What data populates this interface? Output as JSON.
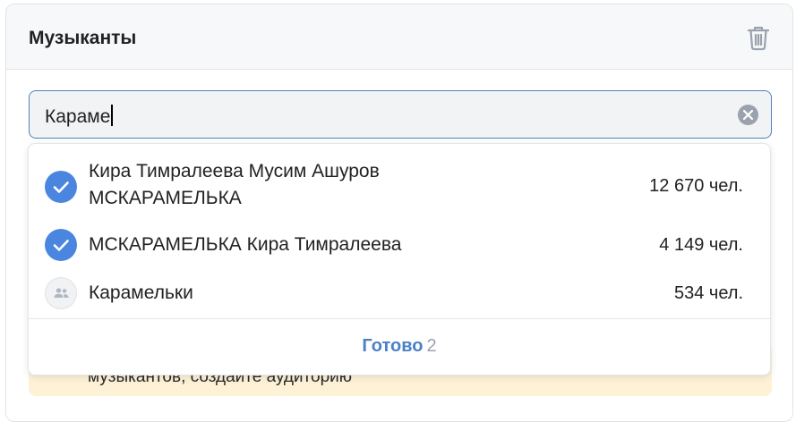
{
  "card": {
    "title": "Музыканты"
  },
  "search": {
    "value": "Караме"
  },
  "warning": {
    "text": "музыкантов, создайте аудиторию"
  },
  "dropdown": {
    "options": [
      {
        "label": "Кира Тимралеева Мусим Ашуров МСКАРАМЕЛЬКА",
        "count": "12 670 чел.",
        "icon": "check-icon",
        "selected": true
      },
      {
        "label": "МСКАРАМЕЛЬКА Кира Тимралеева",
        "count": "4 149 чел.",
        "icon": "check-icon",
        "selected": true
      },
      {
        "label": "Карамельки",
        "count": "534 чел.",
        "icon": "people-icon",
        "selected": false
      }
    ],
    "done_label": "Готово",
    "done_count": "2"
  },
  "colors": {
    "accent": "#4a86e0",
    "link": "#4a80c8",
    "warning_bg": "#fdf1d6"
  }
}
